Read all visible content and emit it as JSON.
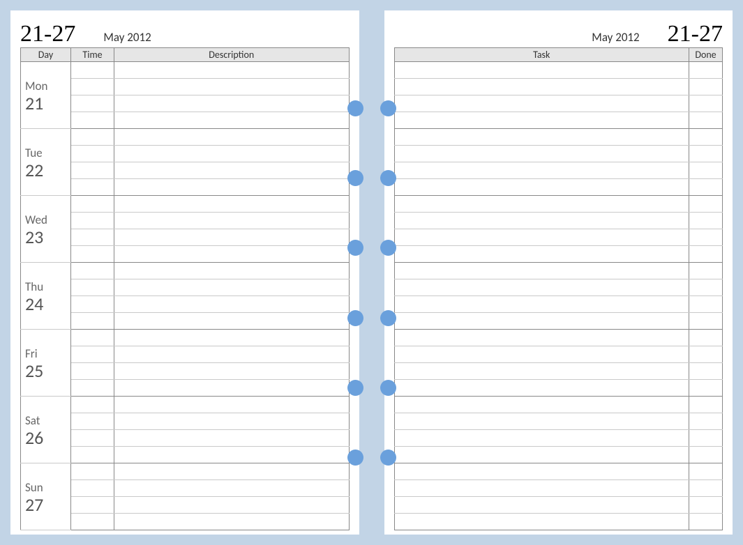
{
  "left": {
    "week_range": "21-27",
    "month_year": "May 2012",
    "columns": {
      "day": "Day",
      "time": "Time",
      "desc": "Description"
    },
    "days": [
      {
        "name": "Mon",
        "num": "21"
      },
      {
        "name": "Tue",
        "num": "22"
      },
      {
        "name": "Wed",
        "num": "23"
      },
      {
        "name": "Thu",
        "num": "24"
      },
      {
        "name": "Fri",
        "num": "25"
      },
      {
        "name": "Sat",
        "num": "26"
      },
      {
        "name": "Sun",
        "num": "27"
      }
    ]
  },
  "right": {
    "month_year": "May 2012",
    "week_range": "21-27",
    "columns": {
      "task": "Task",
      "done": "Done"
    }
  }
}
